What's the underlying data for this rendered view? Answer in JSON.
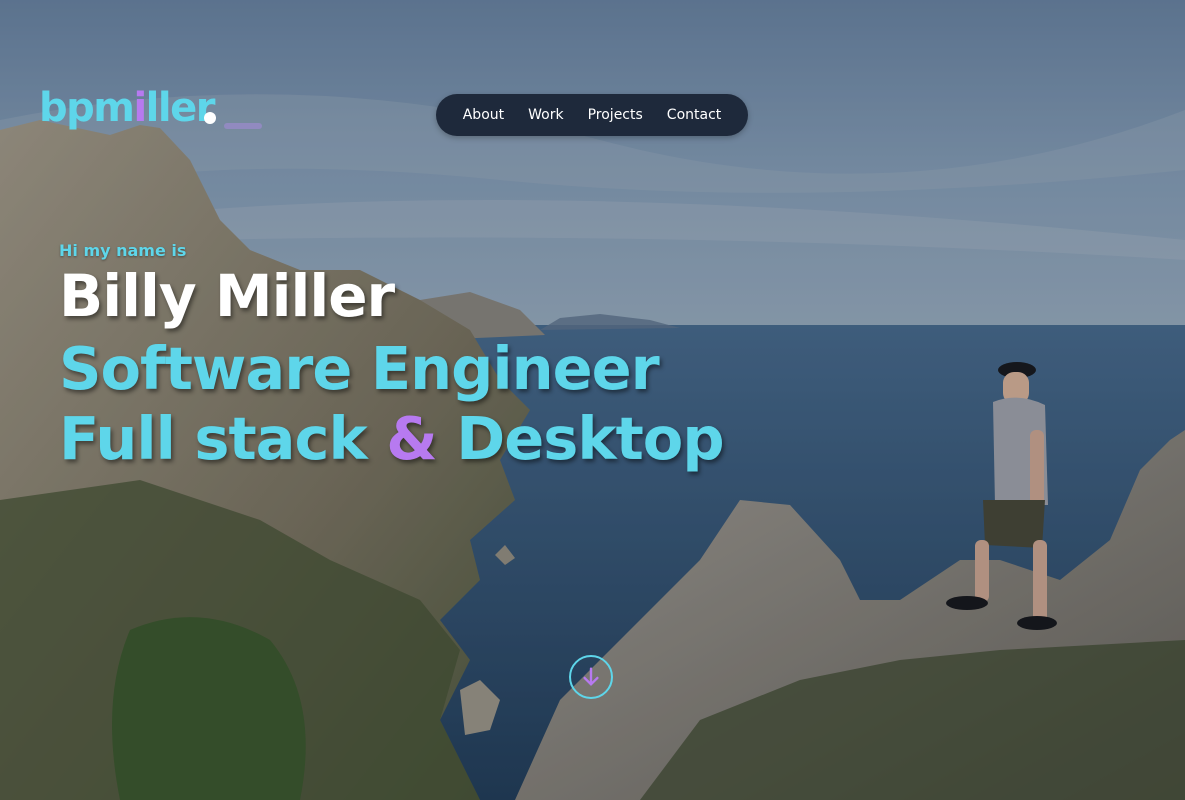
{
  "logo": {
    "text_before": "bpm",
    "text_i": "i",
    "text_after": "ller"
  },
  "nav": {
    "items": [
      {
        "label": "About"
      },
      {
        "label": "Work"
      },
      {
        "label": "Projects"
      },
      {
        "label": "Contact"
      }
    ]
  },
  "hero": {
    "greeting": "Hi my name is",
    "name": "Billy Miller",
    "role": "Software Engineer",
    "stack_part1": "Full stack ",
    "stack_amp": "&",
    "stack_part2": " Desktop"
  },
  "scroll_button": {
    "icon": "arrow-down-icon"
  },
  "colors": {
    "accent_cyan": "#5ed6ea",
    "accent_purple": "#b77af0",
    "nav_bg": "#1e293b"
  }
}
